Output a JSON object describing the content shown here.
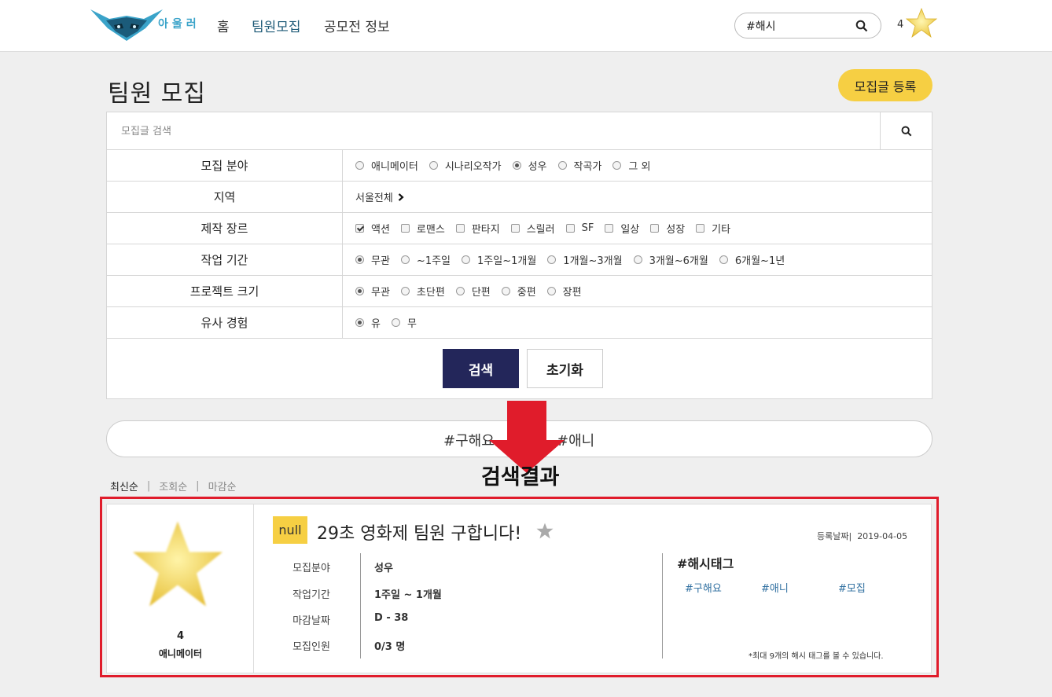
{
  "header": {
    "logo_text": "아울러",
    "nav": [
      "홈",
      "팀원모집",
      "공모전 정보"
    ],
    "hash_search_value": "#해시",
    "user_count": "4"
  },
  "page": {
    "title": "팀원 모집",
    "register_button": "모집글 등록",
    "search_placeholder": "모집글 검색"
  },
  "filters": {
    "field": {
      "label": "모집 분야",
      "options": [
        "애니메이터",
        "시나리오작가",
        "성우",
        "작곡가",
        "그 외"
      ],
      "selected": "성우"
    },
    "region": {
      "label": "지역",
      "value": "서울전체"
    },
    "genre": {
      "label": "제작 장르",
      "options": [
        "액션",
        "로맨스",
        "판타지",
        "스릴러",
        "SF",
        "일상",
        "성장",
        "기타"
      ],
      "checked": [
        "액션"
      ]
    },
    "period": {
      "label": "작업 기간",
      "options": [
        "무관",
        "~1주일",
        "1주일~1개월",
        "1개월~3개월",
        "3개월~6개월",
        "6개월~1년"
      ],
      "selected": "무관"
    },
    "size": {
      "label": "프로젝트 크기",
      "options": [
        "무관",
        "초단편",
        "단편",
        "중편",
        "장편"
      ],
      "selected": "무관"
    },
    "experience": {
      "label": "유사 경험",
      "options": [
        "유",
        "무"
      ],
      "selected": "유"
    },
    "search_button": "검색",
    "reset_button": "초기화"
  },
  "tag_bar": {
    "tags": [
      "#구해요",
      "#애니"
    ]
  },
  "annotation": {
    "label": "검색결과",
    "arrow_color": "#e01c2b"
  },
  "sort": {
    "items": [
      "최신순",
      "조회순",
      "마감순"
    ],
    "active": "최신순"
  },
  "result": {
    "badge": "null",
    "title": "29초 영화제 팀원 구합니다!",
    "registered_label": "등록날짜|",
    "registered_date": "2019-04-05",
    "author_count": "4",
    "author_role": "애니메이터",
    "info": [
      {
        "label": "모집분야",
        "value": "성우"
      },
      {
        "label": "작업기간",
        "value": "1주일 ~ 1개월"
      },
      {
        "label": "마감날짜",
        "value": "D - 38"
      },
      {
        "label": "모집인원",
        "value": "0/3  명"
      }
    ],
    "hashtag_title": "#해시태그",
    "hashtags": [
      "#구해요",
      "#애니",
      "#모집"
    ],
    "hashtag_note": "*최대 9개의 해시 태그를 볼 수 있습니다."
  },
  "colors": {
    "accent_yellow": "#f6cf43",
    "navy_button": "#23265a",
    "highlight_red": "#e01c2b",
    "tag_blue": "#2f6fa0"
  },
  "icons": {
    "search": "magnifier-icon",
    "star": "star-icon",
    "chevron": "chevron-right-icon"
  }
}
